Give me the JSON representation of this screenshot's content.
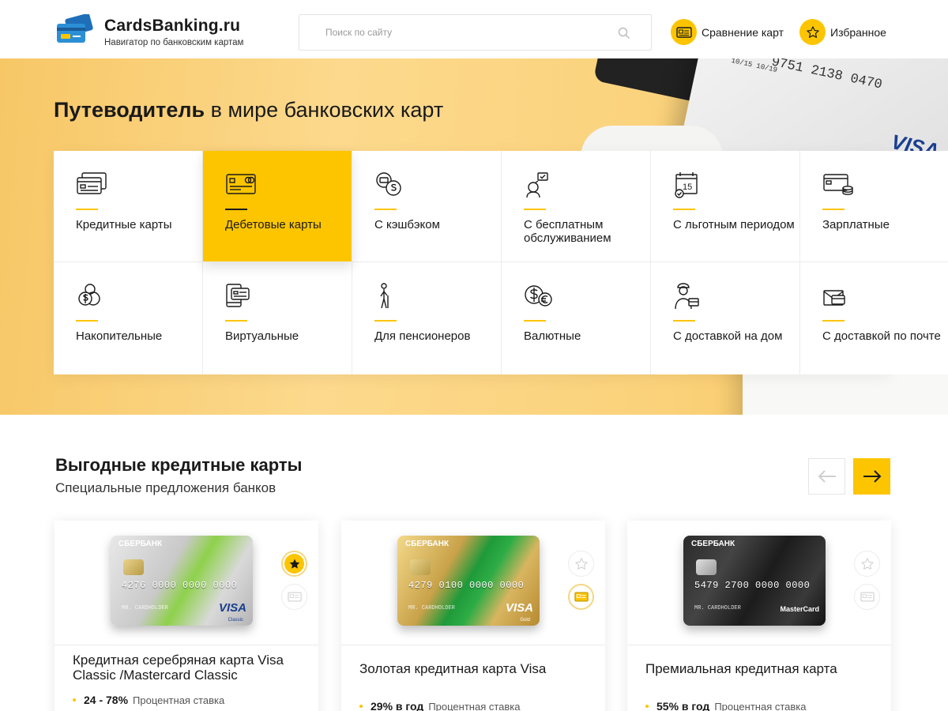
{
  "header": {
    "logo_title": "CardsBanking.ru",
    "logo_subtitle": "Навигатор по банковским картам",
    "search_placeholder": "Поиск по сайту",
    "compare_label": "Сравнение карт",
    "favorites_label": "Избранное"
  },
  "hero": {
    "title_bold": "Путеводитель",
    "title_rest": " в мире банковских карт",
    "deco_card_number": "9751 2138 0470",
    "deco_card_dates": "10/15  10/19",
    "deco_card_brand": "VISA"
  },
  "categories": [
    {
      "label": "Кредитные карты",
      "icon": "credit-cards-icon",
      "active": false
    },
    {
      "label": "Дебетовые карты",
      "icon": "debit-card-icon",
      "active": true
    },
    {
      "label": "С кэшбэком",
      "icon": "cashback-icon",
      "active": false
    },
    {
      "label": "С бесплатным обслуживанием",
      "icon": "free-service-icon",
      "active": false
    },
    {
      "label": "С льготным периодом",
      "icon": "calendar-icon",
      "active": false
    },
    {
      "label": "Зарплатные",
      "icon": "salary-icon",
      "active": false
    },
    {
      "label": "Накопительные",
      "icon": "savings-icon",
      "active": false
    },
    {
      "label": "Виртуальные",
      "icon": "virtual-card-icon",
      "active": false
    },
    {
      "label": "Для пенсионеров",
      "icon": "pensioner-icon",
      "active": false
    },
    {
      "label": "Валютные",
      "icon": "currency-icon",
      "active": false
    },
    {
      "label": "С доставкой на дом",
      "icon": "courier-icon",
      "active": false
    },
    {
      "label": "С доставкой по почте",
      "icon": "mail-icon",
      "active": false
    }
  ],
  "section": {
    "title": "Выгодные кредитные карты",
    "subtitle": "Специальные предложения банков"
  },
  "offers": [
    {
      "name": "Кредитная серебряная карта Visa Classic /Mastercard Classic",
      "rate": "24 - 78%",
      "rate_label": "Процентная ставка",
      "bank": "СБЕРБАНК",
      "card_number": "4276 0000 0000 0000",
      "holder": "MR. CARDHOLDER",
      "brand": "VISA",
      "brand_sub": "Classic",
      "favorite": true,
      "compare": false
    },
    {
      "name": "Золотая кредитная карта Visa",
      "rate": "29% в год",
      "rate_label": "Процентная ставка",
      "bank": "СБЕРБАНК",
      "card_number": "4279 0100 0000 0000",
      "holder": "MR. CARDHOLDER",
      "brand": "VISA",
      "brand_sub": "Gold",
      "favorite": false,
      "compare": true
    },
    {
      "name": "Премиальная кредитная карта",
      "rate": "55% в год",
      "rate_label": "Процентная ставка",
      "bank": "СБЕРБАНК",
      "card_number": "5479 2700 0000 0000",
      "holder": "MR. CARDHOLDER",
      "brand": "MasterCard",
      "brand_sub": "",
      "favorite": false,
      "compare": false
    }
  ],
  "colors": {
    "accent": "#fcc500",
    "text": "#1a1a1a",
    "visa_blue": "#1a3f8f"
  }
}
